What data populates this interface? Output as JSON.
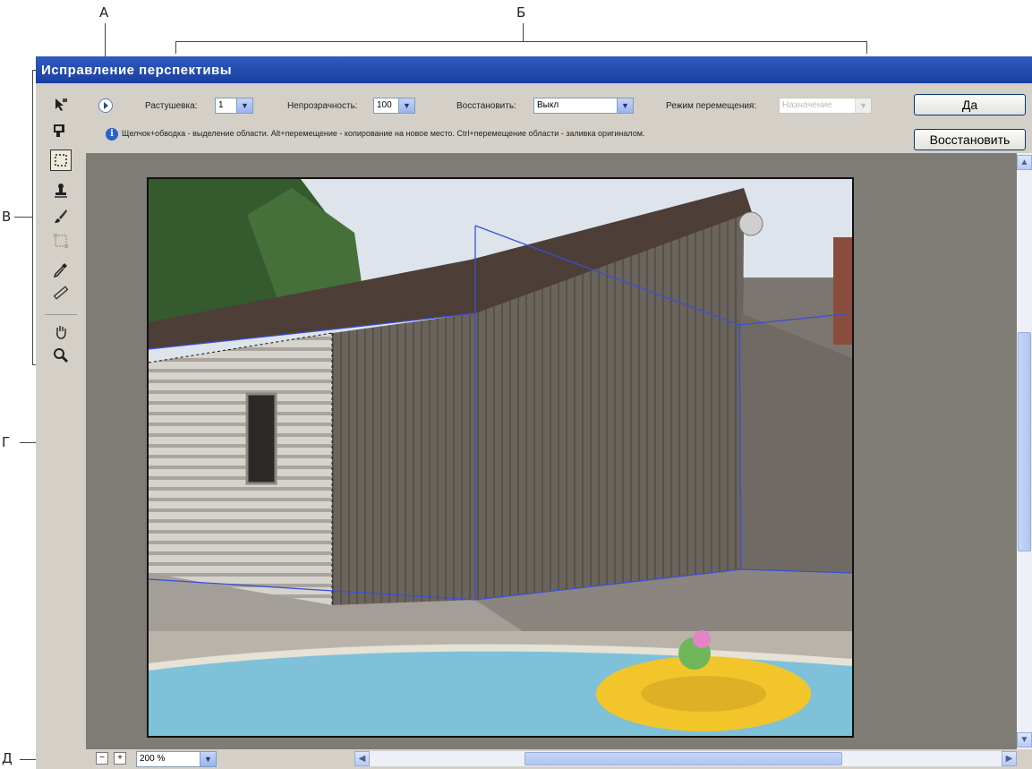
{
  "callouts": {
    "a": "А",
    "b": "Б",
    "v": "В",
    "g": "Г",
    "d": "Д"
  },
  "window": {
    "title": "Исправление перспективы"
  },
  "options": {
    "feather_label": "Растушевка:",
    "feather_value": "1",
    "opacity_label": "Непрозрачность:",
    "opacity_value": "100",
    "heal_label": "Восстановить:",
    "heal_value": "Выкл",
    "move_mode_label": "Режим перемещения:",
    "move_mode_value": "Назначение",
    "hint": "Щелчок+обводка - выделение области. Alt+перемещение - копирование на новое место. Ctrl+перемещение области - заливка оригиналом."
  },
  "buttons": {
    "ok": "Да",
    "reset": "Восстановить"
  },
  "zoom": {
    "value": "200 %",
    "minus": "−",
    "plus": "+"
  },
  "tools": [
    "edit-plane-icon",
    "create-plane-icon",
    "marquee-icon",
    "stamp-icon",
    "brush-icon",
    "transform-icon",
    "eyedropper-icon",
    "measure-icon",
    "hand-icon",
    "zoom-icon"
  ]
}
